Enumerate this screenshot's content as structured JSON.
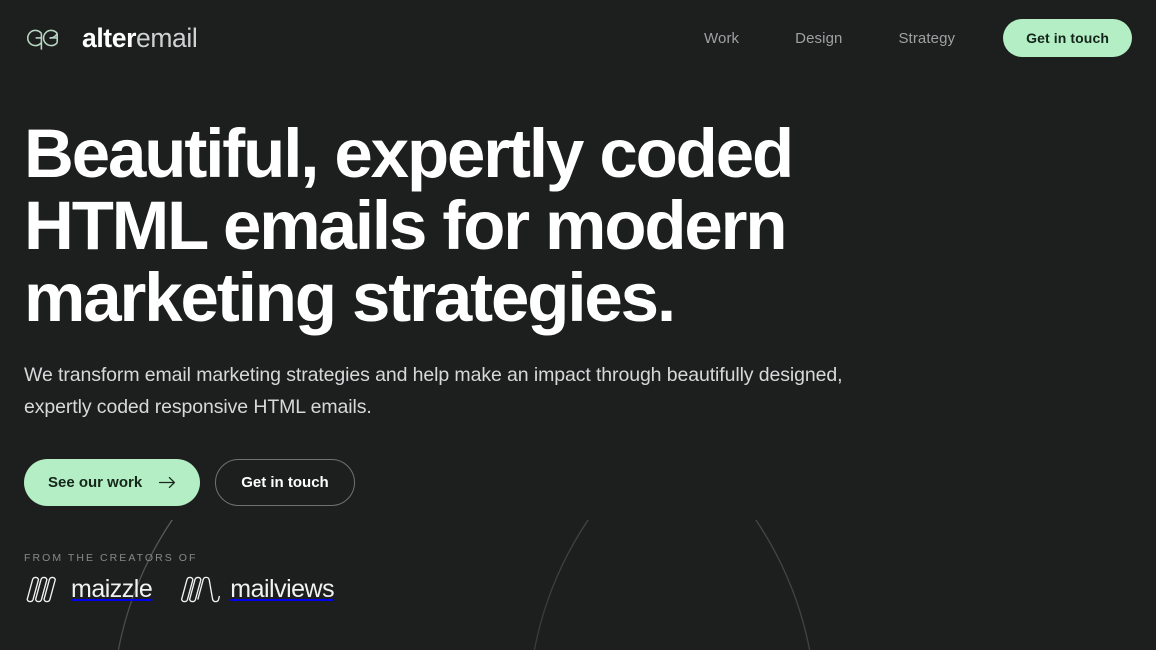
{
  "theme": {
    "background": "#1d1f1f",
    "accent_green": "#b4eec4",
    "heading_color": "#ffffff",
    "muted_text": "#9da1a1"
  },
  "header": {
    "brand": {
      "mark_icon": "alteremail-monogram-icon",
      "name_bold": "alter",
      "name_light": "email"
    },
    "nav": [
      {
        "label": "Work"
      },
      {
        "label": "Design"
      },
      {
        "label": "Strategy"
      }
    ],
    "cta": {
      "label": "Get in touch"
    }
  },
  "hero": {
    "headline": "Beautiful, expertly coded HTML emails for modern marketing strategies.",
    "subheadline": "We transform email marketing strategies and help make an impact through beautifully designed, expertly coded responsive HTML emails.",
    "primary_button": {
      "label": "See our work",
      "icon": "arrow-right-icon"
    },
    "secondary_button": {
      "label": "Get in touch"
    }
  },
  "creators": {
    "label": "From the creators of",
    "logos": [
      {
        "name": "maizzle",
        "mark_icon": "maizzle-mark-icon"
      },
      {
        "name": "mailviews",
        "mark_icon": "mailviews-mark-icon"
      }
    ]
  },
  "decoration": {
    "arc_left_name": "decorative-arc-left",
    "arc_right_name": "decorative-arc-right"
  }
}
